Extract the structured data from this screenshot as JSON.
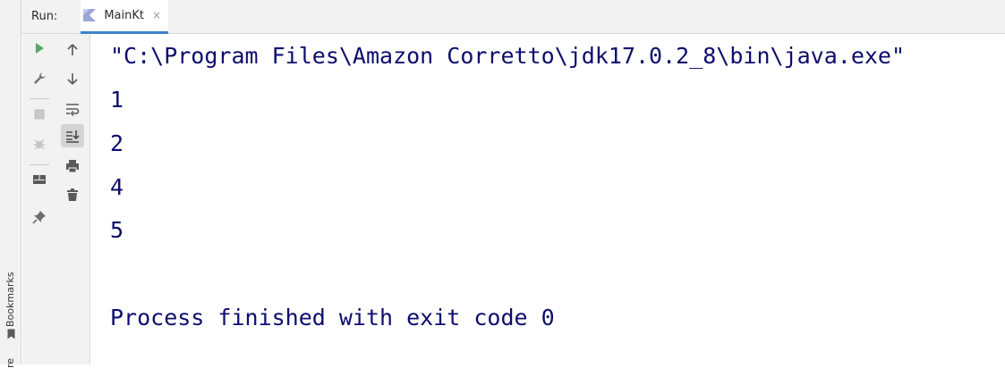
{
  "header": {
    "run_label": "Run:",
    "tab_title": "MainKt",
    "tab_close": "×"
  },
  "side_strip": {
    "bookmarks_label": "Bookmarks",
    "structure_label": "re"
  },
  "toolbar": {
    "col1": [
      {
        "name": "rerun-icon"
      },
      {
        "name": "wrench-icon"
      },
      {
        "name": "stop-icon"
      },
      {
        "name": "debug-disabled-icon"
      },
      {
        "name": "layout-icon"
      },
      {
        "name": "pin-icon"
      }
    ],
    "col2": [
      {
        "name": "up-arrow-icon"
      },
      {
        "name": "down-arrow-icon"
      },
      {
        "name": "soft-wrap-icon"
      },
      {
        "name": "scroll-to-end-icon",
        "active": true
      },
      {
        "name": "print-icon"
      },
      {
        "name": "trash-icon"
      }
    ]
  },
  "console": {
    "lines": [
      "\"C:\\Program Files\\Amazon Corretto\\jdk17.0.2_8\\bin\\java.exe\"",
      "1",
      "2",
      "4",
      "5",
      "",
      "Process finished with exit code 0"
    ]
  },
  "colors": {
    "console_text": "#0d0d6e",
    "tab_underline": "#4083c9",
    "panel_bg": "#f2f2f2",
    "rerun_green": "#59a869"
  }
}
